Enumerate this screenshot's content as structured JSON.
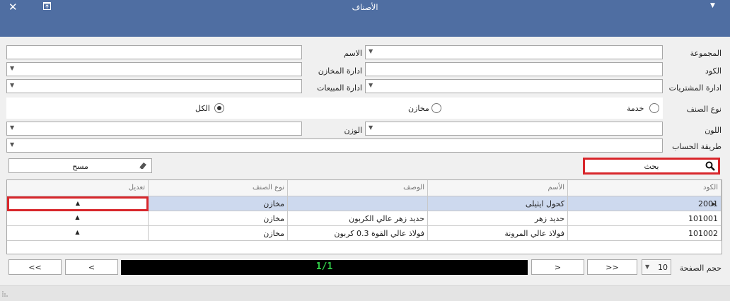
{
  "window": {
    "title": "الأصناف"
  },
  "filters": {
    "group_label": "المجموعة",
    "name_label": "الاسم",
    "code_label": "الكود",
    "warehouse_mgmt_label": "ادارة المخازن",
    "purchases_mgmt_label": "ادارة المشتريات",
    "sales_mgmt_label": "ادارة المبيعات",
    "item_type_label": "نوع الصنف",
    "color_label": "اللون",
    "weight_label": "الوزن",
    "calc_method_label": "طريقة الحساب",
    "item_type_options": [
      {
        "label": "خدمة",
        "checked": false
      },
      {
        "label": "مخازن",
        "checked": false
      },
      {
        "label": "الكل",
        "checked": true
      }
    ]
  },
  "actions": {
    "search_label": "بحث",
    "clear_label": "مسح"
  },
  "grid": {
    "columns": [
      "الكود",
      "الأسم",
      "الوصف",
      "نوع الصنف",
      "تعديل"
    ],
    "rows": [
      {
        "code": "2001",
        "name": "كحول ايثيلى",
        "description": "",
        "type": "مخازن",
        "edit": "▲"
      },
      {
        "code": "101001",
        "name": "حديد زهر",
        "description": "حديد زهر عالي الكربون",
        "type": "مخازن",
        "edit": "▲"
      },
      {
        "code": "101002",
        "name": "فولاذ عالي المرونة",
        "description": "فولاذ عالي القوة 0.3 كربون",
        "type": "مخازن",
        "edit": "▲"
      }
    ]
  },
  "pager": {
    "page_size_label": "حجم الصفحة",
    "page_size_value": "10",
    "first_label": ">>",
    "prev_label": ">",
    "indicator": "1/1",
    "next_label": "<",
    "last_label": "<<"
  }
}
